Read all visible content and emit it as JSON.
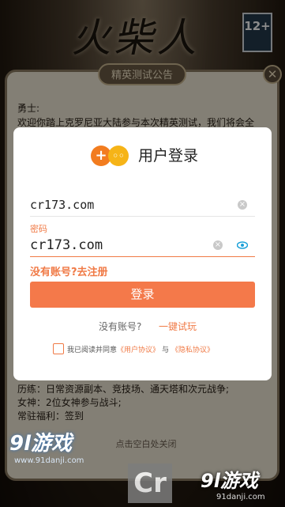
{
  "game": {
    "title": "火柴人",
    "age_rating": "12+"
  },
  "notice": {
    "header": "精英测试公告",
    "close_icon": "close-icon",
    "greeting": "勇士:",
    "intro": "欢迎你踏上克罗尼亚大陆参与本次精英测试，我们将会全",
    "lines": [
      "历练：日常资源副本、竞技场、通天塔和次元战争;",
      "女神：2位女神参与战斗;",
      "常驻福利：签到"
    ],
    "bottom_hint": "点击空白处关闭"
  },
  "login": {
    "title": "用户登录",
    "logo_icon": "gamepad-logo-icon",
    "username_value": "cr173.com",
    "password_label": "密码",
    "password_value": "cr173.com",
    "register_link": "没有账号?去注册",
    "login_button": "登录",
    "no_account_text": "没有账号?",
    "trial_link": "一键试玩",
    "agreement": {
      "prefix": "我已阅读并同意",
      "user_agreement": "《用户协议》",
      "and": "与",
      "privacy": "《隐私协议》"
    },
    "accent_color": "#f07a46"
  },
  "watermarks": {
    "left": "9l游戏",
    "left_sub": "www.91danji.com",
    "right": "9l游戏",
    "right_sub": "91danji.com",
    "bottom_logo": "Cr"
  }
}
